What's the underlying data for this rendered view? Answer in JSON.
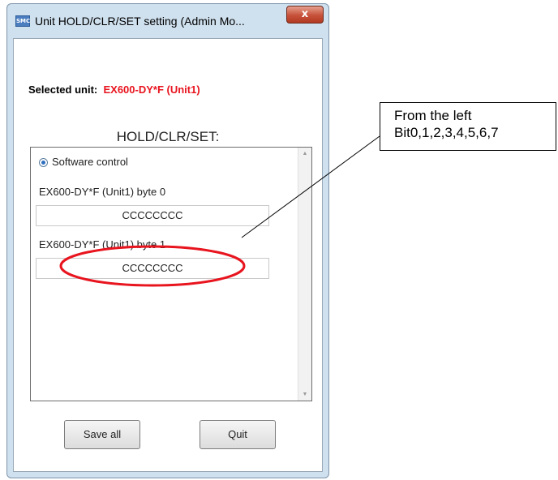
{
  "window": {
    "title": "Unit HOLD/CLR/SET setting (Admin Mo...",
    "icon": "SMC",
    "close_glyph": "x"
  },
  "selected_unit": {
    "label": "Selected unit:",
    "value": "EX600-DY*F (Unit1)",
    "value_color": "#e8141e"
  },
  "section_title": "HOLD/CLR/SET:",
  "panel": {
    "radio_label": "Software control",
    "bytes": [
      {
        "label": "EX600-DY*F (Unit1)  byte 0",
        "value": "CCCCCCCC"
      },
      {
        "label": "EX600-DY*F (Unit1)  byte 1",
        "value": "CCCCCCCC"
      }
    ]
  },
  "buttons": {
    "save_all": "Save all",
    "quit": "Quit"
  },
  "annotation": {
    "line1": "From the left",
    "line2": "Bit0,1,2,3,4,5,6,7",
    "ellipse_color": "#e8141e"
  }
}
